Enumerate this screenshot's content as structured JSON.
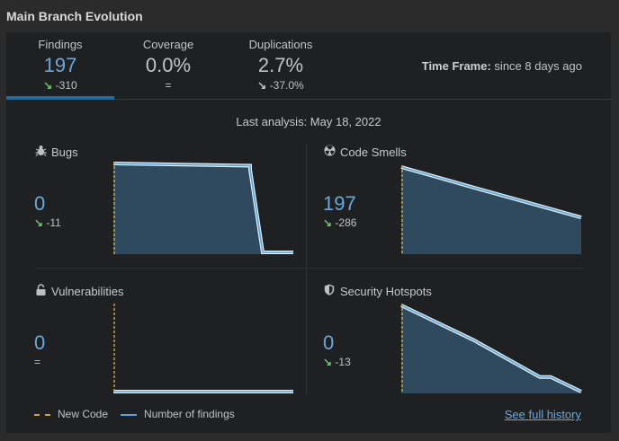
{
  "title": "Main Branch Evolution",
  "tabs": [
    {
      "label": "Findings",
      "value": "197",
      "delta_arrow": "↘",
      "delta": "-310",
      "value_color": "#6aa9df",
      "arrow_color": "#6cc56c"
    },
    {
      "label": "Coverage",
      "value": "0.0%",
      "delta_arrow": "",
      "delta": "=",
      "value_color": "#c3c3c3",
      "arrow_color": "#c3c3c3"
    },
    {
      "label": "Duplications",
      "value": "2.7%",
      "delta_arrow": "↘",
      "delta": "-37.0%",
      "value_color": "#c3c3c3",
      "arrow_color": "#c3c3c3"
    }
  ],
  "timeframe": {
    "label": "Time Frame:",
    "value": " since 8 days ago"
  },
  "analysis": "Last analysis: May 18, 2022",
  "blocks": [
    {
      "key": "bugs",
      "label": "Bugs",
      "icon": "bug-icon",
      "value": "0",
      "delta_arrow": "↘",
      "delta": "-11",
      "series": [
        1,
        0.975,
        0.93,
        0,
        0
      ]
    },
    {
      "key": "code_smells",
      "label": "Code Smells",
      "icon": "radiation-icon",
      "value": "197",
      "delta_arrow": "↘",
      "delta": "-286",
      "series": [
        1,
        0.75,
        0.55,
        0.41
      ]
    },
    {
      "key": "vulnerabilities",
      "label": "Vulnerabilities",
      "icon": "lock-icon",
      "value": "0",
      "delta_arrow": "",
      "delta": "=",
      "series": [
        0,
        0
      ]
    },
    {
      "key": "security_hotspots",
      "label": "Security Hotspots",
      "icon": "shield-icon",
      "value": "0",
      "delta_arrow": "↘",
      "delta": "-13",
      "series": [
        1,
        0.6,
        0.17,
        0.17,
        0
      ]
    }
  ],
  "legend": {
    "new_code": "New Code",
    "findings": "Number of findings"
  },
  "see_history": "See full history",
  "colors": {
    "accent": "#6aa9df",
    "chart_fill": "#2f4a5e",
    "chart_line": "#5aa2d6",
    "new_code": "#c7a53b",
    "green": "#6cc56c"
  }
}
